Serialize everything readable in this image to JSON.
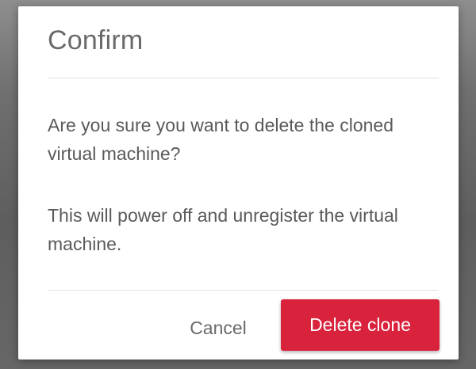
{
  "dialog": {
    "title": "Confirm",
    "message_1": "Are you sure you want to delete the cloned virtual machine?",
    "message_2": "This will power off and unregister the virtual machine.",
    "cancel_label": "Cancel",
    "delete_label": "Delete clone"
  },
  "colors": {
    "danger_button": "#d9223c",
    "title_text": "#6a6a6a",
    "body_text": "#5a5a5a"
  }
}
